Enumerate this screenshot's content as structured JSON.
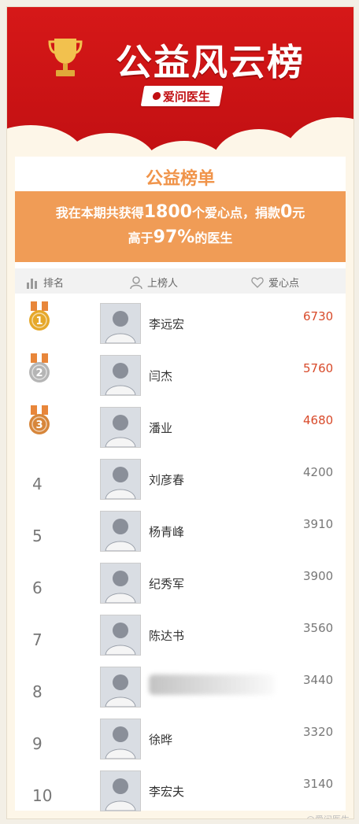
{
  "header": {
    "title": "公益风云榜",
    "brand": "爱问医生"
  },
  "panel": {
    "title": "公益榜单",
    "summary": {
      "line1_prefix": "我在本期共获得",
      "line1_points": "1800",
      "line1_mid": "个爱心点，捐款",
      "line1_amount": "0",
      "line1_suffix": "元",
      "line2_prefix": "高于",
      "line2_percent": "97%",
      "line2_suffix": "的医生"
    },
    "table_headers": {
      "rank": "排名",
      "person": "上榜人",
      "points": "爱心点"
    }
  },
  "rows": [
    {
      "rank": "1",
      "name": "李远宏",
      "points": "6730"
    },
    {
      "rank": "2",
      "name": "闫杰",
      "points": "5760"
    },
    {
      "rank": "3",
      "name": "潘业",
      "points": "4680"
    },
    {
      "rank": "4",
      "name": "刘彦春",
      "points": "4200"
    },
    {
      "rank": "5",
      "name": "杨青峰",
      "points": "3910"
    },
    {
      "rank": "6",
      "name": "纪秀军",
      "points": "3900"
    },
    {
      "rank": "7",
      "name": "陈达书",
      "points": "3560"
    },
    {
      "rank": "8",
      "name": "",
      "points": "3440"
    },
    {
      "rank": "9",
      "name": "徐晔",
      "points": "3320"
    },
    {
      "rank": "10",
      "name": "李宏夫",
      "points": "3140"
    }
  ],
  "colors": {
    "banner_red": "#c10f12",
    "accent_orange": "#f09c56",
    "top_points": "#d84a2a",
    "gold": "#e6a82a",
    "silver": "#b5b5b5",
    "bronze": "#d7863a"
  }
}
